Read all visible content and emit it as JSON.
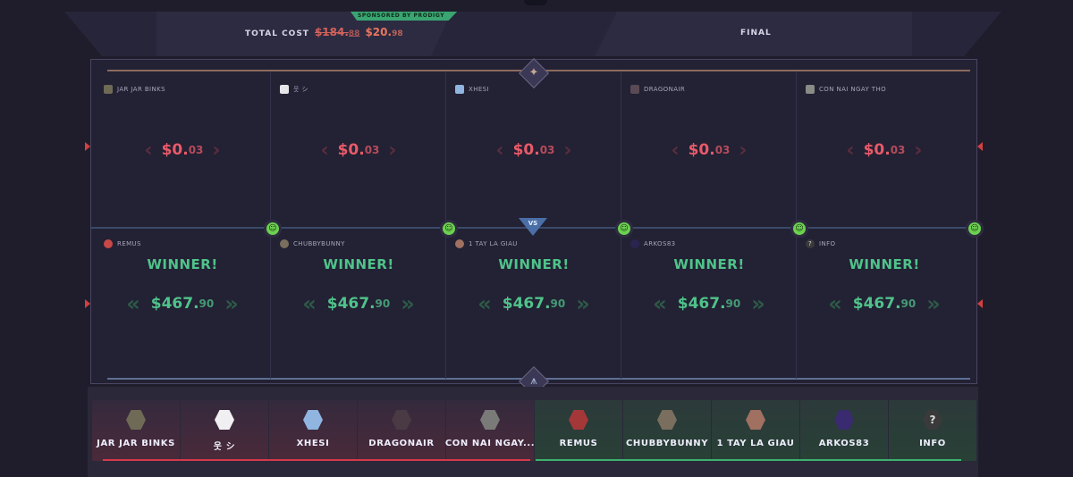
{
  "header": {
    "total_cost_label": "TOTAL COST",
    "old_price": "$184.",
    "old_price_cents": "88",
    "new_price": "$20.",
    "new_price_cents": "98",
    "sponsor": "SPONSORED BY PRODIGY",
    "status": "FINAL"
  },
  "battle": {
    "vs_label": "VS",
    "winner_label": "WINNER!",
    "top_team": [
      {
        "name": "JAR JAR BINKS",
        "cost": "$0.",
        "cents": "03",
        "avatar_color": "#6e6a55"
      },
      {
        "name": "웃 シ",
        "cost": "$0.",
        "cents": "03",
        "avatar_color": "#e6e6ea"
      },
      {
        "name": "XHESI",
        "cost": "$0.",
        "cents": "03",
        "avatar_color": "#8fb5e0"
      },
      {
        "name": "DRAGONAIR",
        "cost": "$0.",
        "cents": "03",
        "avatar_color": "#5a4a55"
      },
      {
        "name": "CON NAI NGAY THO",
        "cost": "$0.",
        "cents": "03",
        "avatar_color": "#8a8a86"
      }
    ],
    "bottom_team": [
      {
        "name": "REMUS",
        "cost": "$467.",
        "cents": "90",
        "avatar_color": "#c84848"
      },
      {
        "name": "CHUBBYBUNNY",
        "cost": "$467.",
        "cents": "90",
        "avatar_color": "#7a6e5e"
      },
      {
        "name": "1 TAY LA GIAU",
        "cost": "$467.",
        "cents": "90",
        "avatar_color": "#a07060"
      },
      {
        "name": "ARKOS83",
        "cost": "$467.",
        "cents": "90",
        "avatar_color": "#2a2450"
      },
      {
        "name": "INFO",
        "cost": "$467.",
        "cents": "90",
        "avatar_color": "#3a3a3a"
      }
    ]
  },
  "tabs": [
    {
      "label": "JAR JAR BINKS",
      "team": "red",
      "avatar_color": "#6e6a55"
    },
    {
      "label": "웃 シ",
      "team": "red",
      "avatar_color": "#f0f0f2"
    },
    {
      "label": "XHESI",
      "team": "red",
      "avatar_color": "#8fb5e0"
    },
    {
      "label": "DRAGONAIR",
      "team": "red",
      "avatar_color": "#4a3a44"
    },
    {
      "label": "CON NAI NGAY...",
      "team": "red",
      "avatar_color": "#7a7a78"
    },
    {
      "label": "REMUS",
      "team": "green",
      "avatar_color": "#a43838"
    },
    {
      "label": "CHUBBYBUNNY",
      "team": "green",
      "avatar_color": "#7a6e5e"
    },
    {
      "label": "1 TAY LA GIAU",
      "team": "green",
      "avatar_color": "#a07060"
    },
    {
      "label": "ARKOS83",
      "team": "green",
      "avatar_color": "#3a2a70"
    },
    {
      "label": "INFO",
      "team": "green",
      "avatar_color": "#3a3a3a"
    }
  ],
  "icons": {
    "avatar_glyph_info": "?",
    "smile_glyph": "☺",
    "emblem_top": "✦",
    "emblem_bottom": "⩚"
  }
}
